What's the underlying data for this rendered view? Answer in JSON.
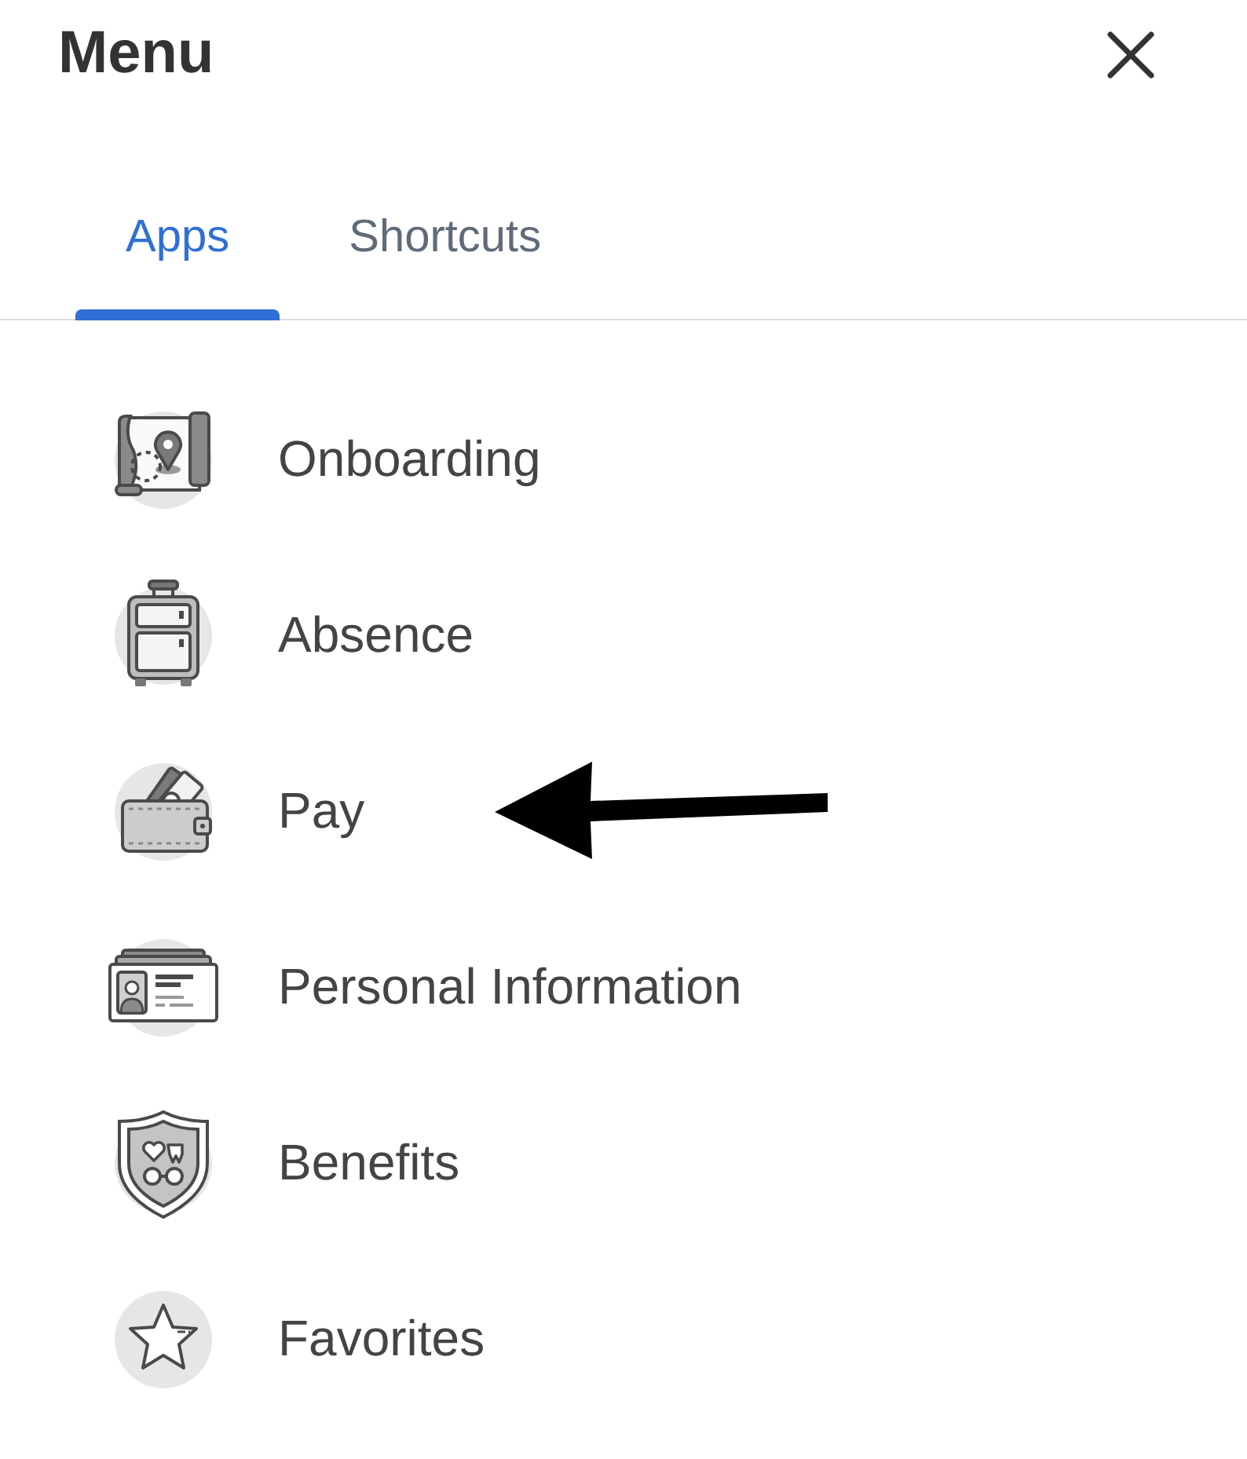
{
  "header": {
    "title": "Menu"
  },
  "tabs": [
    {
      "label": "Apps",
      "selected": true
    },
    {
      "label": "Shortcuts",
      "selected": false
    }
  ],
  "items": [
    {
      "label": "Onboarding",
      "pointed_at": false
    },
    {
      "label": "Absence",
      "pointed_at": false
    },
    {
      "label": "Pay",
      "pointed_at": true
    },
    {
      "label": "Personal Information",
      "pointed_at": false
    },
    {
      "label": "Benefits",
      "pointed_at": false
    },
    {
      "label": "Favorites",
      "pointed_at": false
    }
  ]
}
